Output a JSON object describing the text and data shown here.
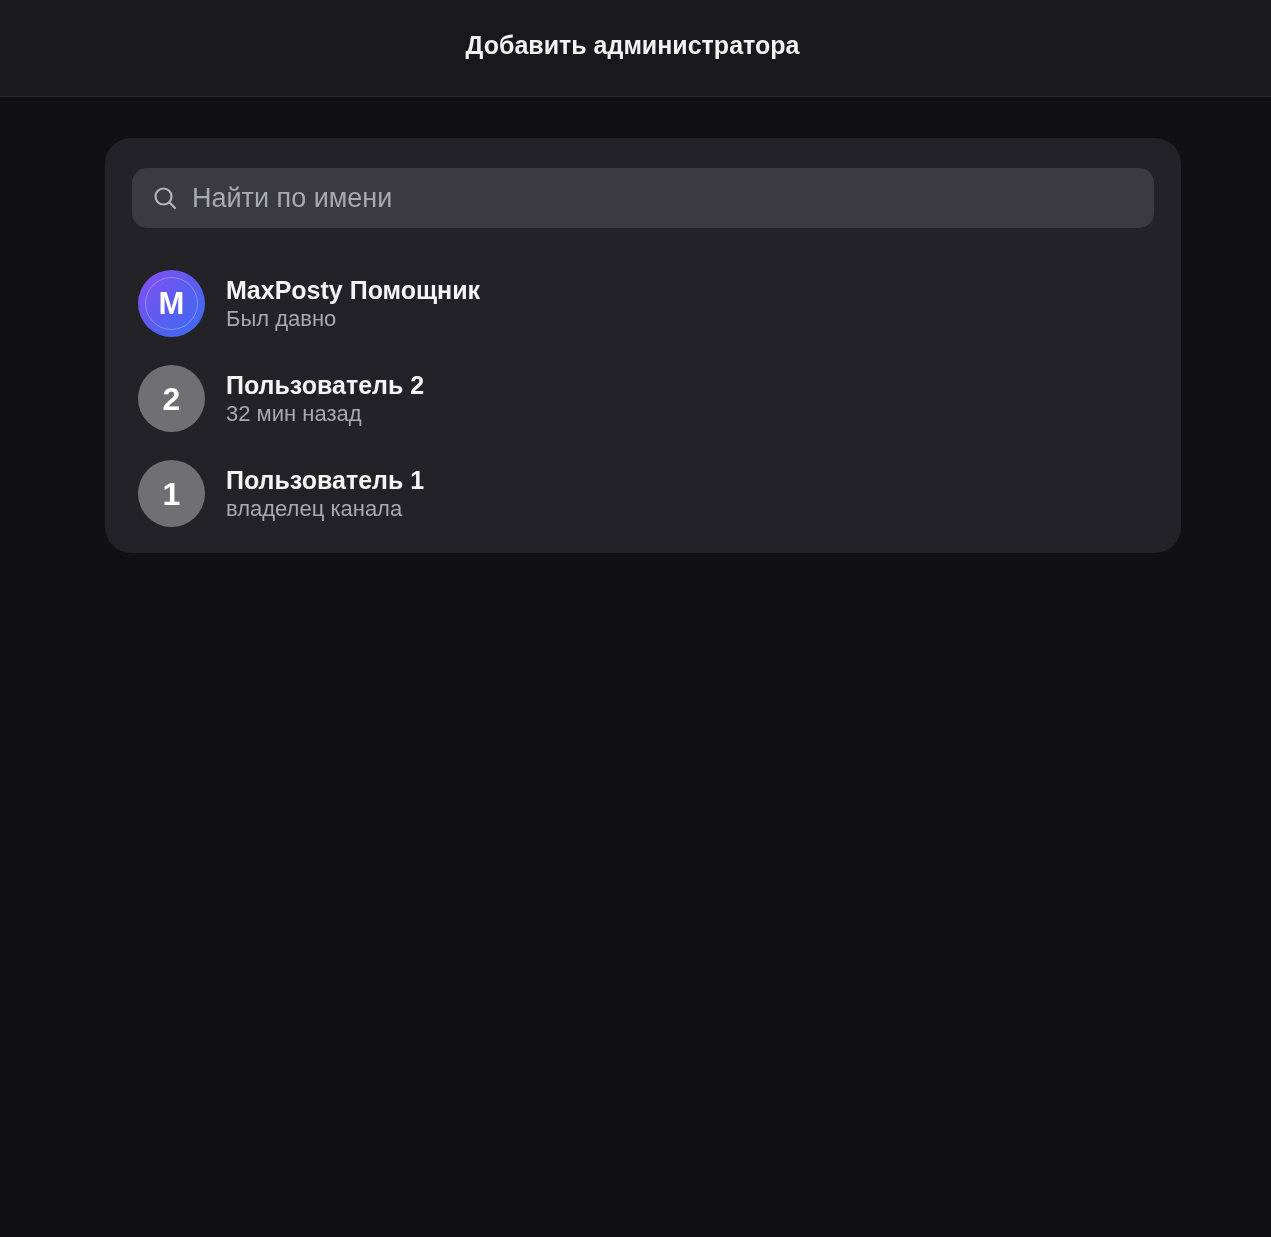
{
  "header": {
    "title": "Добавить администратора"
  },
  "search": {
    "placeholder": "Найти по имени"
  },
  "contacts": [
    {
      "name": "MaxPosty Помощник",
      "status": "Был давно",
      "avatar": {
        "kind": "logo",
        "text": "M"
      }
    },
    {
      "name": "Пользователь 2",
      "status": "32 мин назад",
      "avatar": {
        "kind": "number",
        "text": "2"
      }
    },
    {
      "name": "Пользователь 1",
      "status": "владелец канала",
      "avatar": {
        "kind": "number",
        "text": "1"
      }
    }
  ]
}
